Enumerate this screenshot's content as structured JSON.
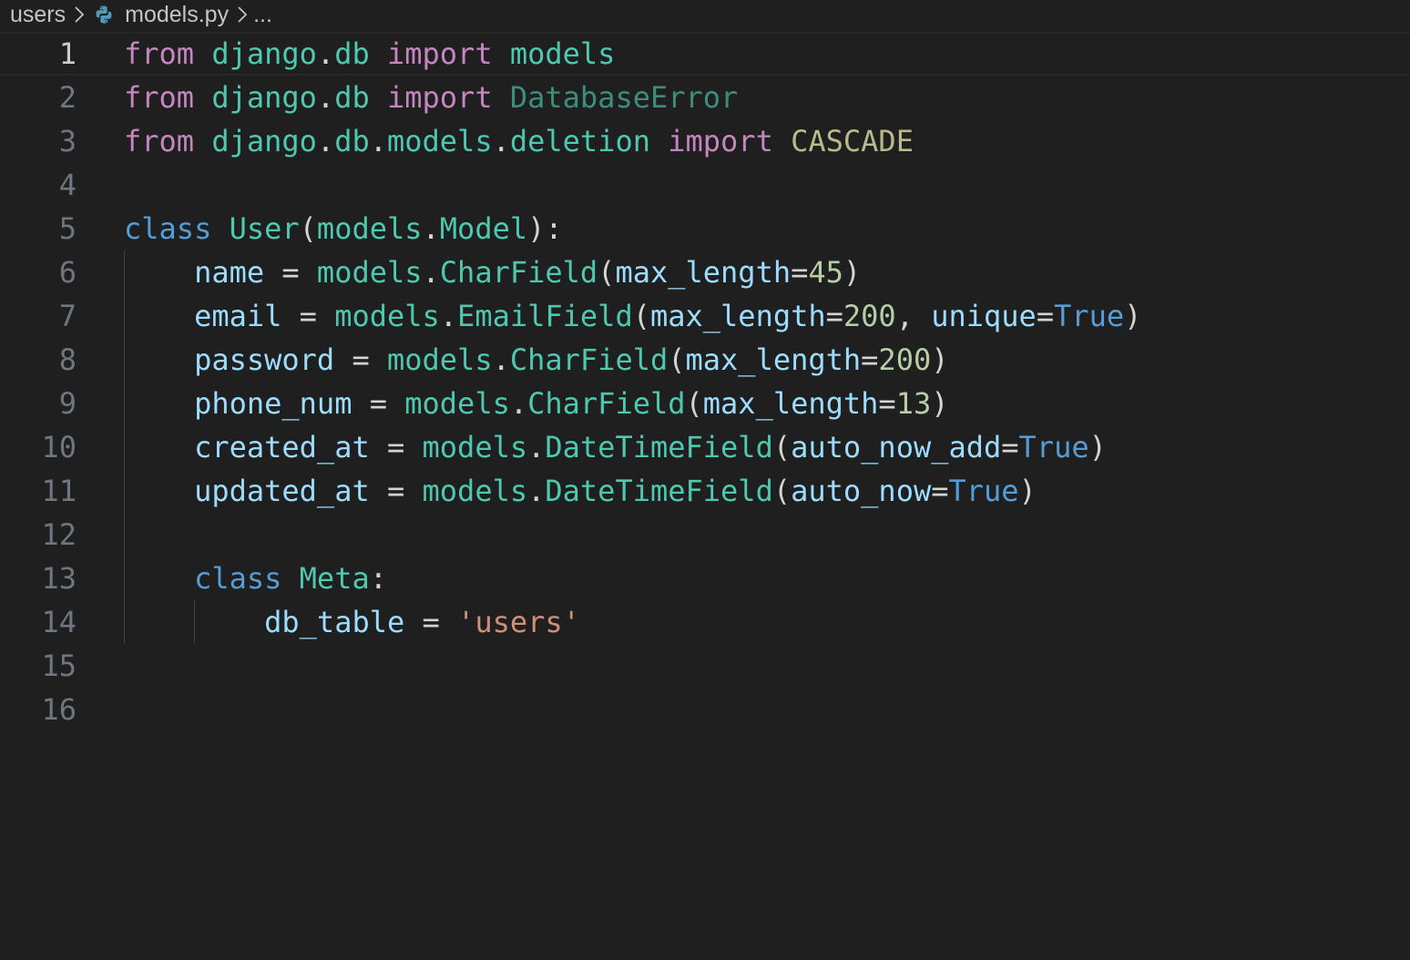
{
  "breadcrumb": {
    "folder": "users",
    "file": "models.py",
    "more": "..."
  },
  "editor": {
    "language": "python",
    "current_line": 1,
    "lines": [
      {
        "number": "1",
        "tokens": [
          {
            "text": "from",
            "kind": "kw-flow"
          },
          {
            "text": " ",
            "kind": "plain"
          },
          {
            "text": "django",
            "kind": "mod"
          },
          {
            "text": ".",
            "kind": "plain"
          },
          {
            "text": "db",
            "kind": "mod"
          },
          {
            "text": " ",
            "kind": "plain"
          },
          {
            "text": "import",
            "kind": "kw-flow"
          },
          {
            "text": " ",
            "kind": "plain"
          },
          {
            "text": "models",
            "kind": "mod"
          }
        ]
      },
      {
        "number": "2",
        "tokens": [
          {
            "text": "from",
            "kind": "kw-flow"
          },
          {
            "text": " ",
            "kind": "plain"
          },
          {
            "text": "django",
            "kind": "mod"
          },
          {
            "text": ".",
            "kind": "plain"
          },
          {
            "text": "db",
            "kind": "mod"
          },
          {
            "text": " ",
            "kind": "plain"
          },
          {
            "text": "import",
            "kind": "kw-flow"
          },
          {
            "text": " ",
            "kind": "plain"
          },
          {
            "text": "DatabaseError",
            "kind": "unused"
          }
        ]
      },
      {
        "number": "3",
        "tokens": [
          {
            "text": "from",
            "kind": "kw-flow"
          },
          {
            "text": " ",
            "kind": "plain"
          },
          {
            "text": "django",
            "kind": "mod"
          },
          {
            "text": ".",
            "kind": "plain"
          },
          {
            "text": "db",
            "kind": "mod"
          },
          {
            "text": ".",
            "kind": "plain"
          },
          {
            "text": "models",
            "kind": "mod"
          },
          {
            "text": ".",
            "kind": "plain"
          },
          {
            "text": "deletion",
            "kind": "mod"
          },
          {
            "text": " ",
            "kind": "plain"
          },
          {
            "text": "import",
            "kind": "kw-flow"
          },
          {
            "text": " ",
            "kind": "plain"
          },
          {
            "text": "CASCADE",
            "kind": "unused-const"
          }
        ]
      },
      {
        "number": "4",
        "tokens": []
      },
      {
        "number": "5",
        "tokens": [
          {
            "text": "class",
            "kind": "kw"
          },
          {
            "text": " ",
            "kind": "plain"
          },
          {
            "text": "User",
            "kind": "cls"
          },
          {
            "text": "(",
            "kind": "plain"
          },
          {
            "text": "models",
            "kind": "mod"
          },
          {
            "text": ".",
            "kind": "plain"
          },
          {
            "text": "Model",
            "kind": "cls"
          },
          {
            "text": "):",
            "kind": "plain"
          }
        ]
      },
      {
        "number": "6",
        "tokens": [
          {
            "text": "    ",
            "kind": "plain"
          },
          {
            "text": "name",
            "kind": "var"
          },
          {
            "text": " = ",
            "kind": "plain"
          },
          {
            "text": "models",
            "kind": "mod"
          },
          {
            "text": ".",
            "kind": "plain"
          },
          {
            "text": "CharField",
            "kind": "cls"
          },
          {
            "text": "(",
            "kind": "plain"
          },
          {
            "text": "max_length",
            "kind": "var"
          },
          {
            "text": "=",
            "kind": "plain"
          },
          {
            "text": "45",
            "kind": "num"
          },
          {
            "text": ")",
            "kind": "plain"
          }
        ]
      },
      {
        "number": "7",
        "tokens": [
          {
            "text": "    ",
            "kind": "plain"
          },
          {
            "text": "email",
            "kind": "var"
          },
          {
            "text": " = ",
            "kind": "plain"
          },
          {
            "text": "models",
            "kind": "mod"
          },
          {
            "text": ".",
            "kind": "plain"
          },
          {
            "text": "EmailField",
            "kind": "cls"
          },
          {
            "text": "(",
            "kind": "plain"
          },
          {
            "text": "max_length",
            "kind": "var"
          },
          {
            "text": "=",
            "kind": "plain"
          },
          {
            "text": "200",
            "kind": "num"
          },
          {
            "text": ", ",
            "kind": "plain"
          },
          {
            "text": "unique",
            "kind": "var"
          },
          {
            "text": "=",
            "kind": "plain"
          },
          {
            "text": "True",
            "kind": "kw"
          },
          {
            "text": ")",
            "kind": "plain"
          }
        ]
      },
      {
        "number": "8",
        "tokens": [
          {
            "text": "    ",
            "kind": "plain"
          },
          {
            "text": "password",
            "kind": "var"
          },
          {
            "text": " = ",
            "kind": "plain"
          },
          {
            "text": "models",
            "kind": "mod"
          },
          {
            "text": ".",
            "kind": "plain"
          },
          {
            "text": "CharField",
            "kind": "cls"
          },
          {
            "text": "(",
            "kind": "plain"
          },
          {
            "text": "max_length",
            "kind": "var"
          },
          {
            "text": "=",
            "kind": "plain"
          },
          {
            "text": "200",
            "kind": "num"
          },
          {
            "text": ")",
            "kind": "plain"
          }
        ]
      },
      {
        "number": "9",
        "tokens": [
          {
            "text": "    ",
            "kind": "plain"
          },
          {
            "text": "phone_num",
            "kind": "var"
          },
          {
            "text": " = ",
            "kind": "plain"
          },
          {
            "text": "models",
            "kind": "mod"
          },
          {
            "text": ".",
            "kind": "plain"
          },
          {
            "text": "CharField",
            "kind": "cls"
          },
          {
            "text": "(",
            "kind": "plain"
          },
          {
            "text": "max_length",
            "kind": "var"
          },
          {
            "text": "=",
            "kind": "plain"
          },
          {
            "text": "13",
            "kind": "num"
          },
          {
            "text": ")",
            "kind": "plain"
          }
        ]
      },
      {
        "number": "10",
        "tokens": [
          {
            "text": "    ",
            "kind": "plain"
          },
          {
            "text": "created_at",
            "kind": "var"
          },
          {
            "text": " = ",
            "kind": "plain"
          },
          {
            "text": "models",
            "kind": "mod"
          },
          {
            "text": ".",
            "kind": "plain"
          },
          {
            "text": "DateTimeField",
            "kind": "cls"
          },
          {
            "text": "(",
            "kind": "plain"
          },
          {
            "text": "auto_now_add",
            "kind": "var"
          },
          {
            "text": "=",
            "kind": "plain"
          },
          {
            "text": "True",
            "kind": "kw"
          },
          {
            "text": ")",
            "kind": "plain"
          }
        ]
      },
      {
        "number": "11",
        "tokens": [
          {
            "text": "    ",
            "kind": "plain"
          },
          {
            "text": "updated_at",
            "kind": "var"
          },
          {
            "text": " = ",
            "kind": "plain"
          },
          {
            "text": "models",
            "kind": "mod"
          },
          {
            "text": ".",
            "kind": "plain"
          },
          {
            "text": "DateTimeField",
            "kind": "cls"
          },
          {
            "text": "(",
            "kind": "plain"
          },
          {
            "text": "auto_now",
            "kind": "var"
          },
          {
            "text": "=",
            "kind": "plain"
          },
          {
            "text": "True",
            "kind": "kw"
          },
          {
            "text": ")",
            "kind": "plain"
          }
        ]
      },
      {
        "number": "12",
        "tokens": []
      },
      {
        "number": "13",
        "tokens": [
          {
            "text": "    ",
            "kind": "plain"
          },
          {
            "text": "class",
            "kind": "kw"
          },
          {
            "text": " ",
            "kind": "plain"
          },
          {
            "text": "Meta",
            "kind": "cls"
          },
          {
            "text": ":",
            "kind": "plain"
          }
        ]
      },
      {
        "number": "14",
        "tokens": [
          {
            "text": "        ",
            "kind": "plain"
          },
          {
            "text": "db_table",
            "kind": "var"
          },
          {
            "text": " = ",
            "kind": "plain"
          },
          {
            "text": "'users'",
            "kind": "str"
          }
        ]
      },
      {
        "number": "15",
        "tokens": []
      },
      {
        "number": "16",
        "tokens": []
      }
    ]
  }
}
